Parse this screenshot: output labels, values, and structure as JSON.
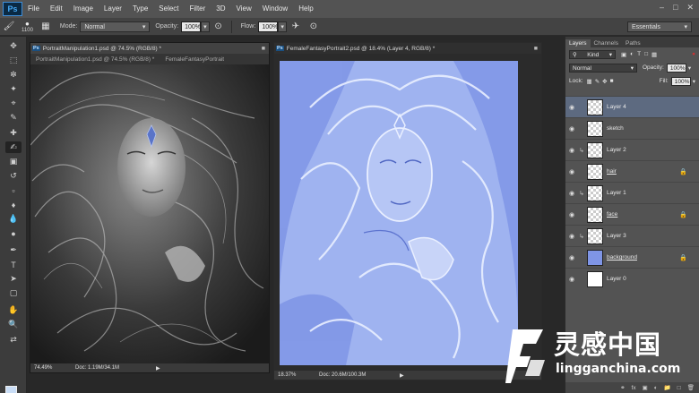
{
  "app": {
    "logo": "Ps"
  },
  "menu": [
    "File",
    "Edit",
    "Image",
    "Layer",
    "Type",
    "Select",
    "Filter",
    "3D",
    "View",
    "Window",
    "Help"
  ],
  "window_controls": [
    "minimize-icon",
    "maximize-icon",
    "close-icon"
  ],
  "options_bar": {
    "brush_size": "1100",
    "mode_label": "Mode:",
    "mode_value": "Normal",
    "opacity_label": "Opacity:",
    "opacity_value": "100%",
    "flow_label": "Flow:",
    "flow_value": "100%",
    "workspace": "Essentials"
  },
  "documents": [
    {
      "title": "PortraitManipulation1.psd @ 74.5% (RGB/8) *",
      "tabs": [
        "PortraitManipulation1.psd @ 74.5% (RGB/8) *",
        "FemaleFantasyPortrait"
      ],
      "zoom": "74.49%",
      "doc_info": "Doc: 1.19M/34.1M"
    },
    {
      "title": "FemaleFantasyPortrait2.psd @ 18.4% (Layer 4, RGB/8) *",
      "zoom": "18.37%",
      "doc_info": "Doc: 20.6M/100.3M"
    }
  ],
  "panels": {
    "tabs": [
      "Layers",
      "Channels",
      "Paths"
    ],
    "filter_kind": "Kind",
    "blend_mode": "Normal",
    "opacity_label": "Opacity:",
    "opacity_value": "100%",
    "lock_label": "Lock:",
    "fill_label": "Fill:",
    "fill_value": "100%",
    "layers": [
      {
        "name": "Layer 4",
        "selected": true,
        "clipped": false,
        "locked": false,
        "thumb": "checker"
      },
      {
        "name": "sketch",
        "selected": false,
        "clipped": false,
        "locked": false,
        "thumb": "checker"
      },
      {
        "name": "Layer 2",
        "selected": false,
        "clipped": true,
        "locked": false,
        "thumb": "checker"
      },
      {
        "name": "hair",
        "selected": false,
        "clipped": false,
        "locked": true,
        "thumb": "checker"
      },
      {
        "name": "Layer 1",
        "selected": false,
        "clipped": true,
        "locked": false,
        "thumb": "checker"
      },
      {
        "name": "face",
        "selected": false,
        "clipped": false,
        "locked": true,
        "thumb": "checker"
      },
      {
        "name": "Layer 3",
        "selected": false,
        "clipped": true,
        "locked": false,
        "thumb": "checker"
      },
      {
        "name": "background",
        "selected": false,
        "clipped": false,
        "locked": true,
        "thumb": "blue"
      },
      {
        "name": "Layer 0",
        "selected": false,
        "clipped": false,
        "locked": false,
        "thumb": "white"
      }
    ],
    "footer_icons": [
      "link-icon",
      "fx-icon",
      "mask-icon",
      "adjustment-icon",
      "group-icon",
      "new-layer-icon",
      "trash-icon"
    ],
    "footer_fx": "fx"
  },
  "watermark": {
    "cn": "灵感中国",
    "en": "lingganchina.com"
  },
  "colors": {
    "foreground": "#c9ddf6",
    "background": "#ffffff",
    "selected_layer": "#5d6a80",
    "sketch_blue": "#8aa6ee"
  }
}
